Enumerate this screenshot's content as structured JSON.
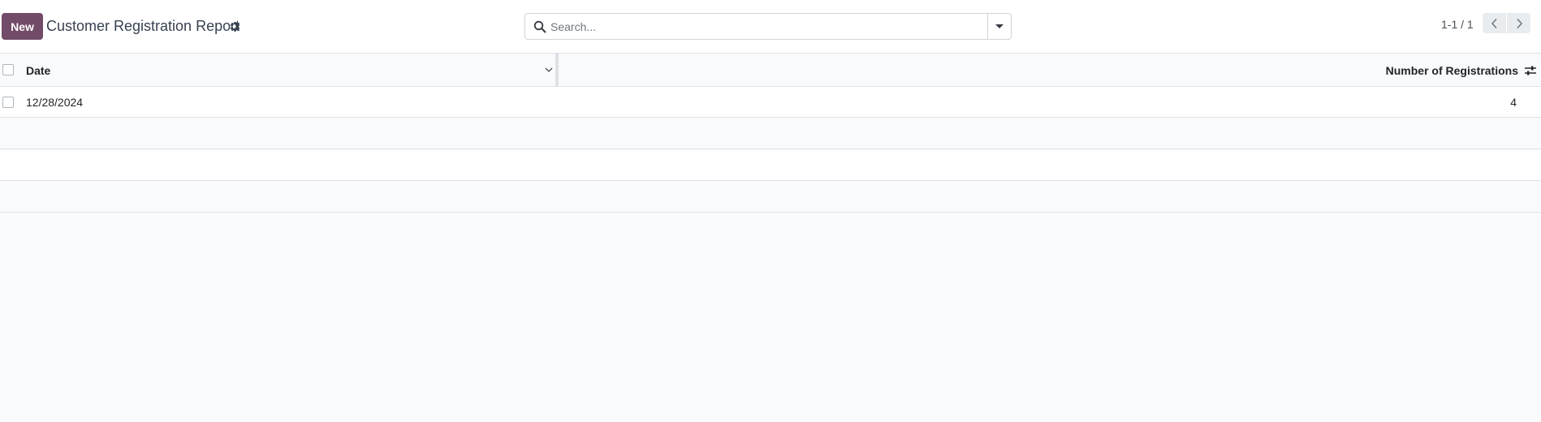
{
  "control_panel": {
    "new_label": "New",
    "title": "Customer Registration Report",
    "actions_icon": "gear-icon",
    "search": {
      "placeholder": "Search...",
      "value": "",
      "icon": "search-icon",
      "toggle_icon": "caret-down-icon"
    },
    "pager": {
      "value": "1-1 / 1",
      "prev_icon": "chevron-left-icon",
      "next_icon": "chevron-right-icon"
    }
  },
  "list": {
    "columns": [
      {
        "label": "Date",
        "icon": "chevron-down-icon"
      },
      {
        "label": "Number of Registrations",
        "icon": "sliders-icon"
      }
    ],
    "rows": [
      {
        "date": "12/28/2024",
        "count": "4"
      }
    ]
  },
  "colors": {
    "primary": "#714b67",
    "list_bg": "#f9fafb",
    "border": "#dee2e6"
  }
}
